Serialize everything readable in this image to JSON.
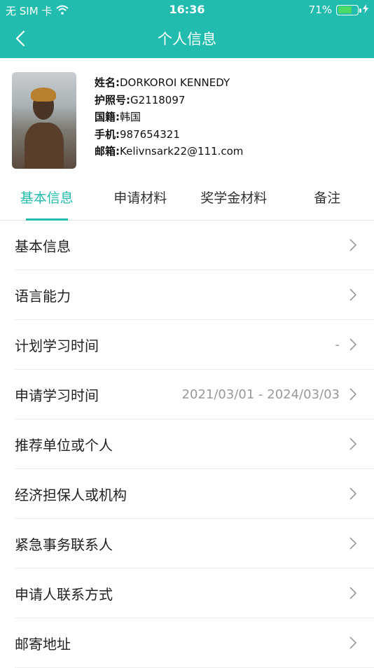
{
  "status_bar": {
    "carrier": "无 SIM 卡",
    "time": "16:36",
    "battery_percent": "71%",
    "battery_level": 0.71
  },
  "nav": {
    "title": "个人信息"
  },
  "profile": {
    "name_label": "姓名:",
    "name": "DORKOROI KENNEDY",
    "passport_label": "护照号:",
    "passport": "G2118097",
    "nationality_label": "国籍:",
    "nationality": "韩国",
    "phone_label": "手机:",
    "phone": "987654321",
    "email_label": "邮箱:",
    "email": "Kelivnsark22@111.com"
  },
  "tabs": [
    {
      "label": "基本信息",
      "active": true
    },
    {
      "label": "申请材料",
      "active": false
    },
    {
      "label": "奖学金材料",
      "active": false
    },
    {
      "label": "备注",
      "active": false
    }
  ],
  "list": [
    {
      "label": "基本信息",
      "value": ""
    },
    {
      "label": "语言能力",
      "value": ""
    },
    {
      "label": "计划学习时间",
      "value": "-"
    },
    {
      "label": "申请学习时间",
      "value": "2021/03/01 - 2024/03/03"
    },
    {
      "label": "推荐单位或个人",
      "value": ""
    },
    {
      "label": "经济担保人或机构",
      "value": ""
    },
    {
      "label": "紧急事务联系人",
      "value": ""
    },
    {
      "label": "申请人联系方式",
      "value": ""
    },
    {
      "label": "邮寄地址",
      "value": ""
    }
  ],
  "colors": {
    "accent": "#22bcae",
    "battery": "#4cd964"
  }
}
